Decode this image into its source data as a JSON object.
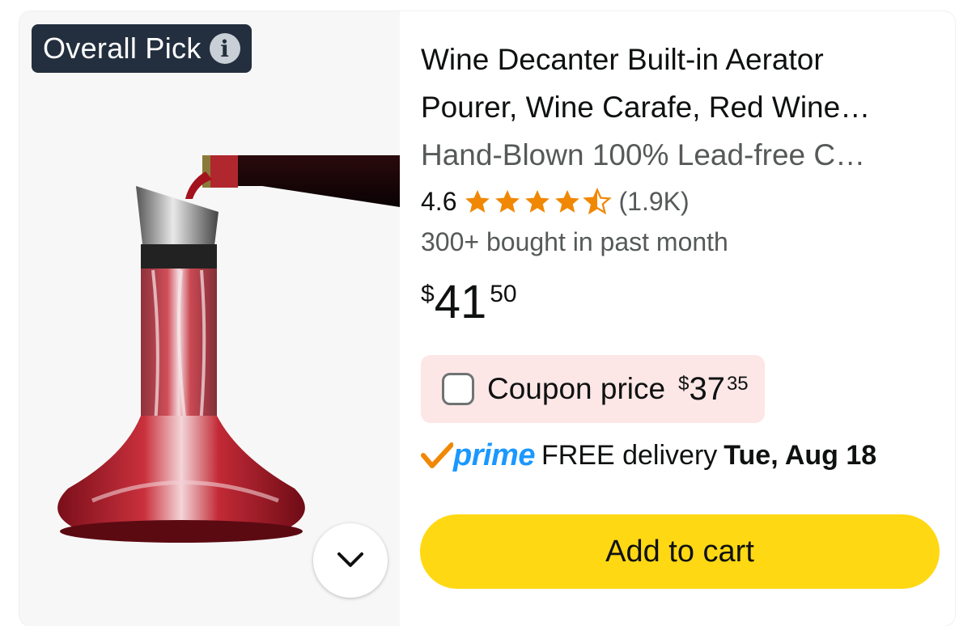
{
  "badge": {
    "label": "Overall Pick",
    "info_icon": "info-icon"
  },
  "product": {
    "title": "Wine Decanter Built-in Aerator Pourer, Wine Carafe, Red Wine…",
    "title_line1": "Wine Decanter Built-in Aerator",
    "title_line2": "Pourer, Wine Carafe, Red Wine…",
    "subtitle": "Hand-Blown 100% Lead-free C…",
    "image_icon": "wine-decanter-image"
  },
  "rating": {
    "value": "4.6",
    "stars": 4.5,
    "max_stars": 5,
    "count": "(1.9K)",
    "star_color": "#f08804"
  },
  "bought": "300+ bought in past month",
  "price": {
    "symbol": "$",
    "whole": "41",
    "fraction": "50"
  },
  "coupon": {
    "checked": false,
    "label": "Coupon price",
    "symbol": "$",
    "whole": "37",
    "fraction": "35",
    "bg_color": "#fde6e6"
  },
  "delivery": {
    "prime": "prime",
    "text": "FREE delivery",
    "date": "Tue, Aug 18",
    "prime_color": "#1a98ff",
    "check_color": "#f08804"
  },
  "cart": {
    "label": "Add to cart",
    "color": "#ffd814"
  },
  "expand": {
    "icon": "chevron-down-icon"
  }
}
